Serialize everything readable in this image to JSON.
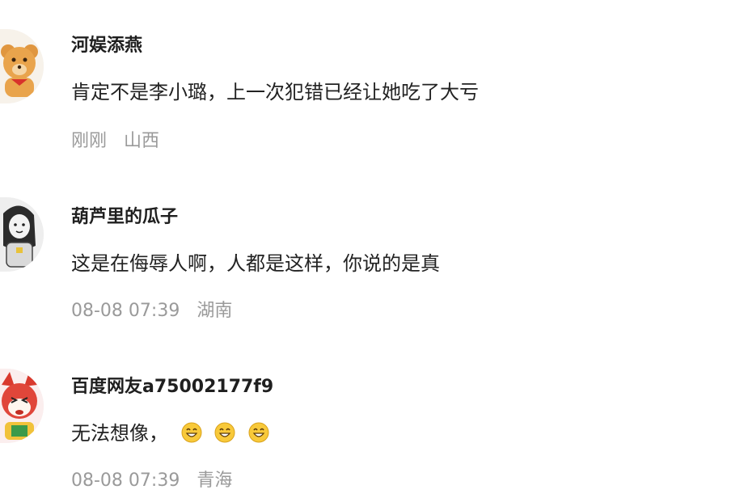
{
  "comments": [
    {
      "username": "河娱添燕",
      "text": "肯定不是李小璐，上一次犯错已经让她吃了大亏",
      "time": "刚刚",
      "location": "山西",
      "avatar_icon": "teddy-bear-avatar-icon"
    },
    {
      "username": "葫芦里的瓜子",
      "text": "这是在侮辱人啊，人都是这样，你说的是真",
      "time": "08-08 07:39",
      "location": "湖南",
      "avatar_icon": "sketch-figure-avatar-icon"
    },
    {
      "username": "百度网友a75002177f9",
      "text": "无法想像，",
      "emojis": [
        "grinning-face-emoji",
        "grinning-face-emoji",
        "grinning-face-emoji"
      ],
      "time": "08-08 07:39",
      "location": "青海",
      "avatar_icon": "red-fox-cartoon-avatar-icon"
    }
  ],
  "colors": {
    "username": "#1f1f1f",
    "text": "#222222",
    "meta": "#9a9a9a",
    "emoji_face": "#f8c93a"
  }
}
